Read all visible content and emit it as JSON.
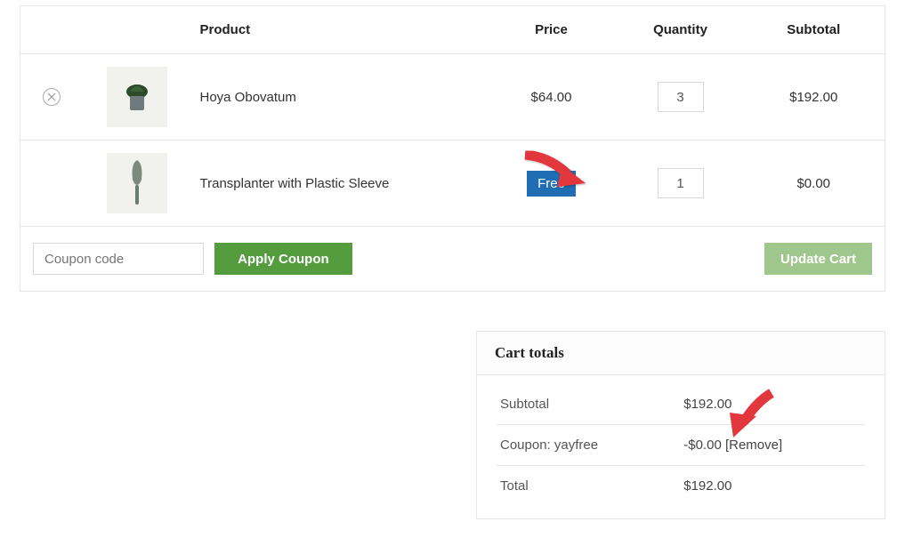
{
  "headers": {
    "product": "Product",
    "price": "Price",
    "quantity": "Quantity",
    "subtotal": "Subtotal"
  },
  "items": [
    {
      "name": "Hoya Obovatum",
      "price": "$64.00",
      "price_is_free": false,
      "qty": "3",
      "subtotal": "$192.00",
      "removable": true
    },
    {
      "name": "Transplanter with Plastic Sleeve",
      "price": "Free",
      "price_is_free": true,
      "qty": "1",
      "subtotal": "$0.00",
      "removable": false
    }
  ],
  "coupon": {
    "placeholder": "Coupon code",
    "apply_label": "Apply Coupon",
    "update_label": "Update Cart"
  },
  "totals": {
    "title": "Cart totals",
    "subtotal_label": "Subtotal",
    "subtotal_value": "$192.00",
    "coupon_label": "Coupon: yayfree",
    "coupon_value": "-$0.00",
    "coupon_remove": "[Remove]",
    "total_label": "Total",
    "total_value": "$192.00"
  }
}
